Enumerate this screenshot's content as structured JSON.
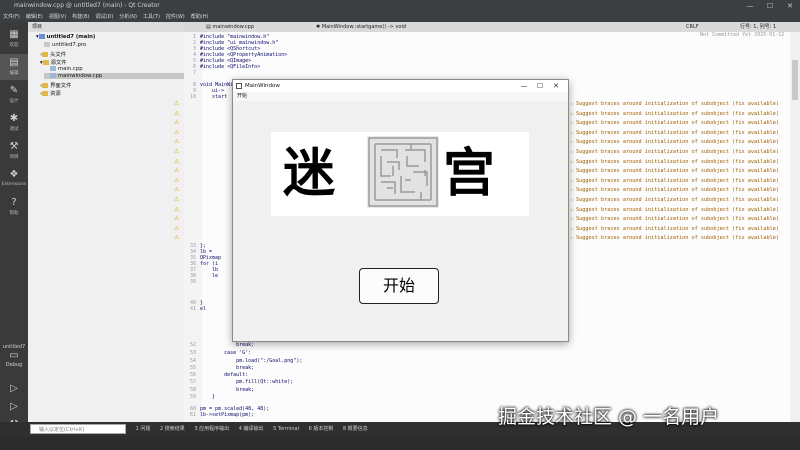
{
  "title_bar": {
    "text": "mainwindow.cpp @ untitled7 (main) - Qt Creator",
    "minimize": "—",
    "maximize": "☐",
    "close": "✕"
  },
  "menu": [
    "文件(F)",
    "编辑(E)",
    "视图(V)",
    "构建(B)",
    "调试(D)",
    "分析(N)",
    "工具(T)",
    "控件(W)",
    "帮助(H)"
  ],
  "modes": [
    {
      "label": "欢迎",
      "icon": "grid-icon"
    },
    {
      "label": "编辑",
      "icon": "edit-icon"
    },
    {
      "label": "设计",
      "icon": "pen-icon"
    },
    {
      "label": "调试",
      "icon": "bug-icon"
    },
    {
      "label": "项目",
      "icon": "wrench-icon"
    },
    {
      "label": "Extensions",
      "icon": "puzzle-icon"
    },
    {
      "label": "帮助",
      "icon": "help-icon"
    }
  ],
  "kit": {
    "project": "untitled7",
    "label": "Debug"
  },
  "project_panel": {
    "header": "项目",
    "items": [
      {
        "label": "untitled7 (main)",
        "level": 0
      },
      {
        "label": "untitled7.pro",
        "level": 1
      },
      {
        "label": "头文件",
        "level": 1
      },
      {
        "label": "源文件",
        "level": 1
      },
      {
        "label": "main.cpp",
        "level": 2
      },
      {
        "label": "mainwindow.cpp",
        "level": 2
      },
      {
        "label": "界面文件",
        "level": 1
      },
      {
        "label": "资源",
        "level": 1
      }
    ]
  },
  "editor_tabs": {
    "file": "mainwindow.cpp",
    "function": "MainWindow::startgame() -> void",
    "encoding": "CRLF",
    "position": "行号: 1, 列号: 1"
  },
  "editor_info": "Not Committed Yet 2025-01-12",
  "code_lines": [
    {
      "n": "1",
      "text": "#include \"mainwindow.h\""
    },
    {
      "n": "2",
      "text": "#include \"ui_mainwindow.h\""
    },
    {
      "n": "3",
      "text": "#include <QShortcut>"
    },
    {
      "n": "4",
      "text": "#include <QPropertyAnimation>"
    },
    {
      "n": "5",
      "text": "#include <QImage>"
    },
    {
      "n": "6",
      "text": "#include <QFileInfo>"
    },
    {
      "n": "7",
      "text": ""
    },
    {
      "n": "8",
      "text": "void MainWindow::startgame(){"
    },
    {
      "n": "9",
      "text": "    ui->"
    },
    {
      "n": "10",
      "text": "    start"
    },
    {
      "n": "33",
      "text": "};"
    },
    {
      "n": "34",
      "text": "lb ="
    },
    {
      "n": "35",
      "text": "QPixmap"
    },
    {
      "n": "36",
      "text": "for (i"
    },
    {
      "n": "37",
      "text": "    lb"
    },
    {
      "n": "38",
      "text": "    le"
    },
    {
      "n": "39",
      "text": ""
    },
    {
      "n": "40",
      "text": "}"
    },
    {
      "n": "41",
      "text": "el"
    },
    {
      "n": "52",
      "text": "            break;"
    },
    {
      "n": "53",
      "text": "        case 'G':"
    },
    {
      "n": "54",
      "text": "            pm.load(\":/Goal.png\");"
    },
    {
      "n": "55",
      "text": "            break;"
    },
    {
      "n": "56",
      "text": "        default:"
    },
    {
      "n": "57",
      "text": "            pm.fill(Qt::white);"
    },
    {
      "n": "58",
      "text": "            break;"
    },
    {
      "n": "59",
      "text": "    }"
    },
    {
      "n": "60",
      "text": "pm = pm.scaled(48, 48);"
    },
    {
      "n": "61",
      "text": "lb->setPixmap(pm);"
    }
  ],
  "warning_text": "Suggest braces around initialization of subobject (fix available)",
  "warning_count": 15,
  "mainwindow": {
    "title": "MainWindow",
    "menu": "开始",
    "chars": [
      "迷",
      "宫"
    ],
    "start_button": "开始",
    "minimize": "—",
    "maximize": "☐",
    "close": "✕"
  },
  "bottom_tabs": [
    "1 问题",
    "2 搜索结果",
    "3 应用程序输出",
    "4 编译输出",
    "5 Terminal",
    "6 版本控制",
    "8 概要信息"
  ],
  "locator_placeholder": "输入以定位(Ctrl+K)",
  "watermark": "掘金技术社区 @ 一名用户"
}
